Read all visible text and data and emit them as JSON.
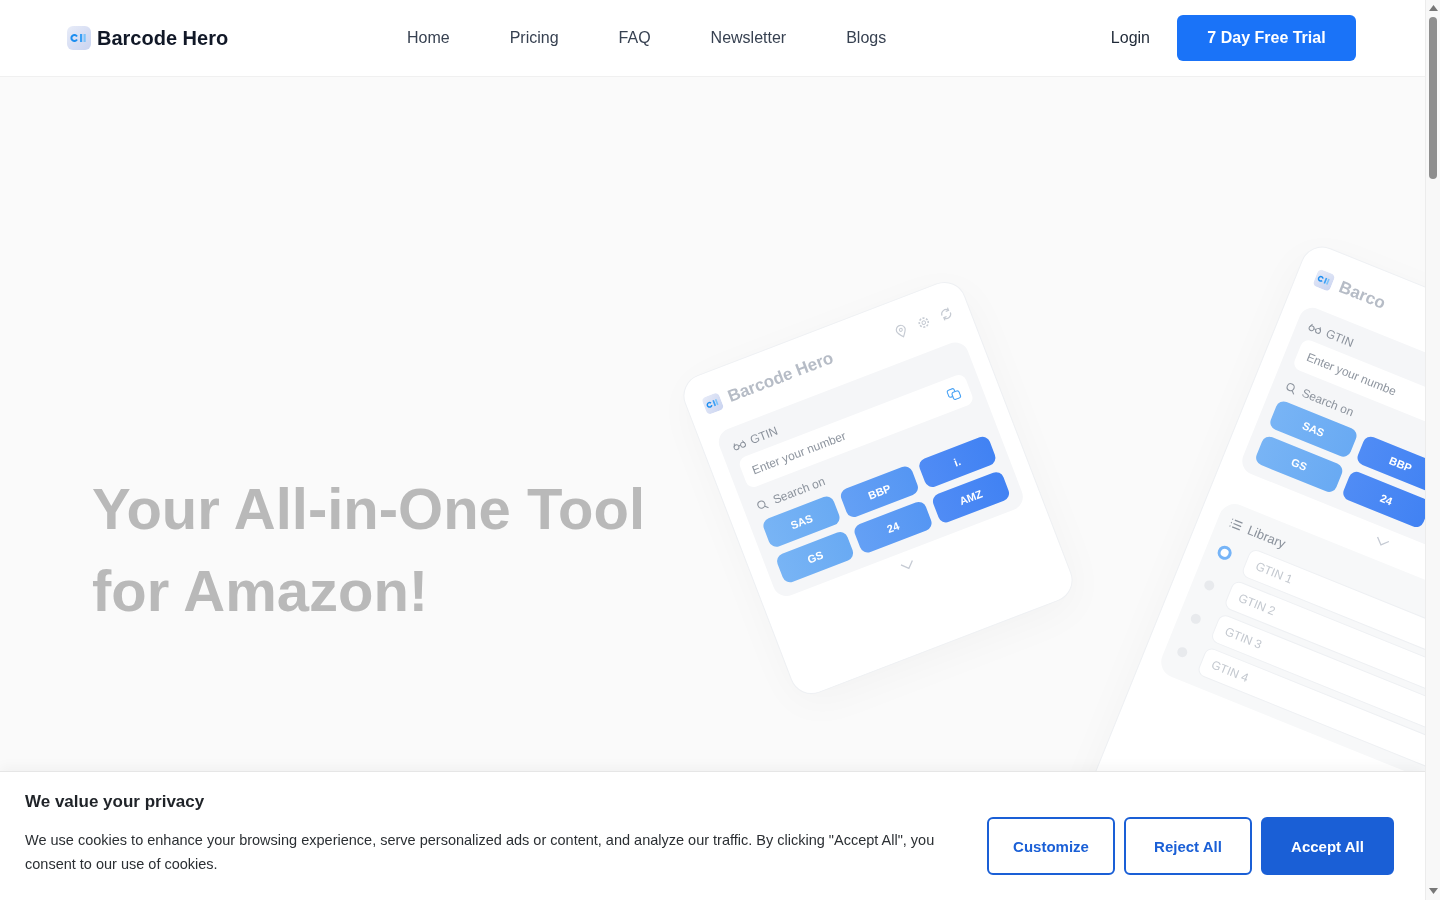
{
  "header": {
    "brand": "Barcode Hero",
    "nav": [
      {
        "label": "Home"
      },
      {
        "label": "Pricing"
      },
      {
        "label": "FAQ"
      },
      {
        "label": "Newsletter"
      },
      {
        "label": "Blogs"
      }
    ],
    "login": "Login",
    "cta": "7 Day Free Trial"
  },
  "hero": {
    "headline_lines": [
      "Your All-in-One Tool",
      "for Amazon!"
    ]
  },
  "mockup_front": {
    "brand": "Barcode Hero",
    "gtin_label": "GTIN",
    "gtin_placeholder": "Enter your number",
    "search_label": "Search on",
    "sites": [
      "SAS",
      "BBP",
      "i.",
      "GS",
      "24",
      "AMZ"
    ]
  },
  "mockup_side": {
    "brand": "Barco",
    "gtin_label": "GTIN",
    "gtin_placeholder": "Enter your numbe",
    "search_label": "Search on",
    "sites": [
      "SAS",
      "BBP",
      "GS",
      "24"
    ],
    "library_label": "Library",
    "library": [
      {
        "label": "GTIN 1",
        "selected": true
      },
      {
        "label": "GTIN 2",
        "selected": false
      },
      {
        "label": "GTIN 3",
        "selected": false
      },
      {
        "label": "GTIN 4",
        "selected": false
      }
    ]
  },
  "cookie_banner": {
    "title": "We value your privacy",
    "text": "We use cookies to enhance your browsing experience, serve personalized ads or content, and analyze our traffic. By clicking \"Accept All\", you consent to our use of cookies.",
    "buttons": [
      {
        "label": "Customize",
        "kind": "outline"
      },
      {
        "label": "Reject All",
        "kind": "outline"
      },
      {
        "label": "Accept All",
        "kind": "filled"
      }
    ]
  }
}
